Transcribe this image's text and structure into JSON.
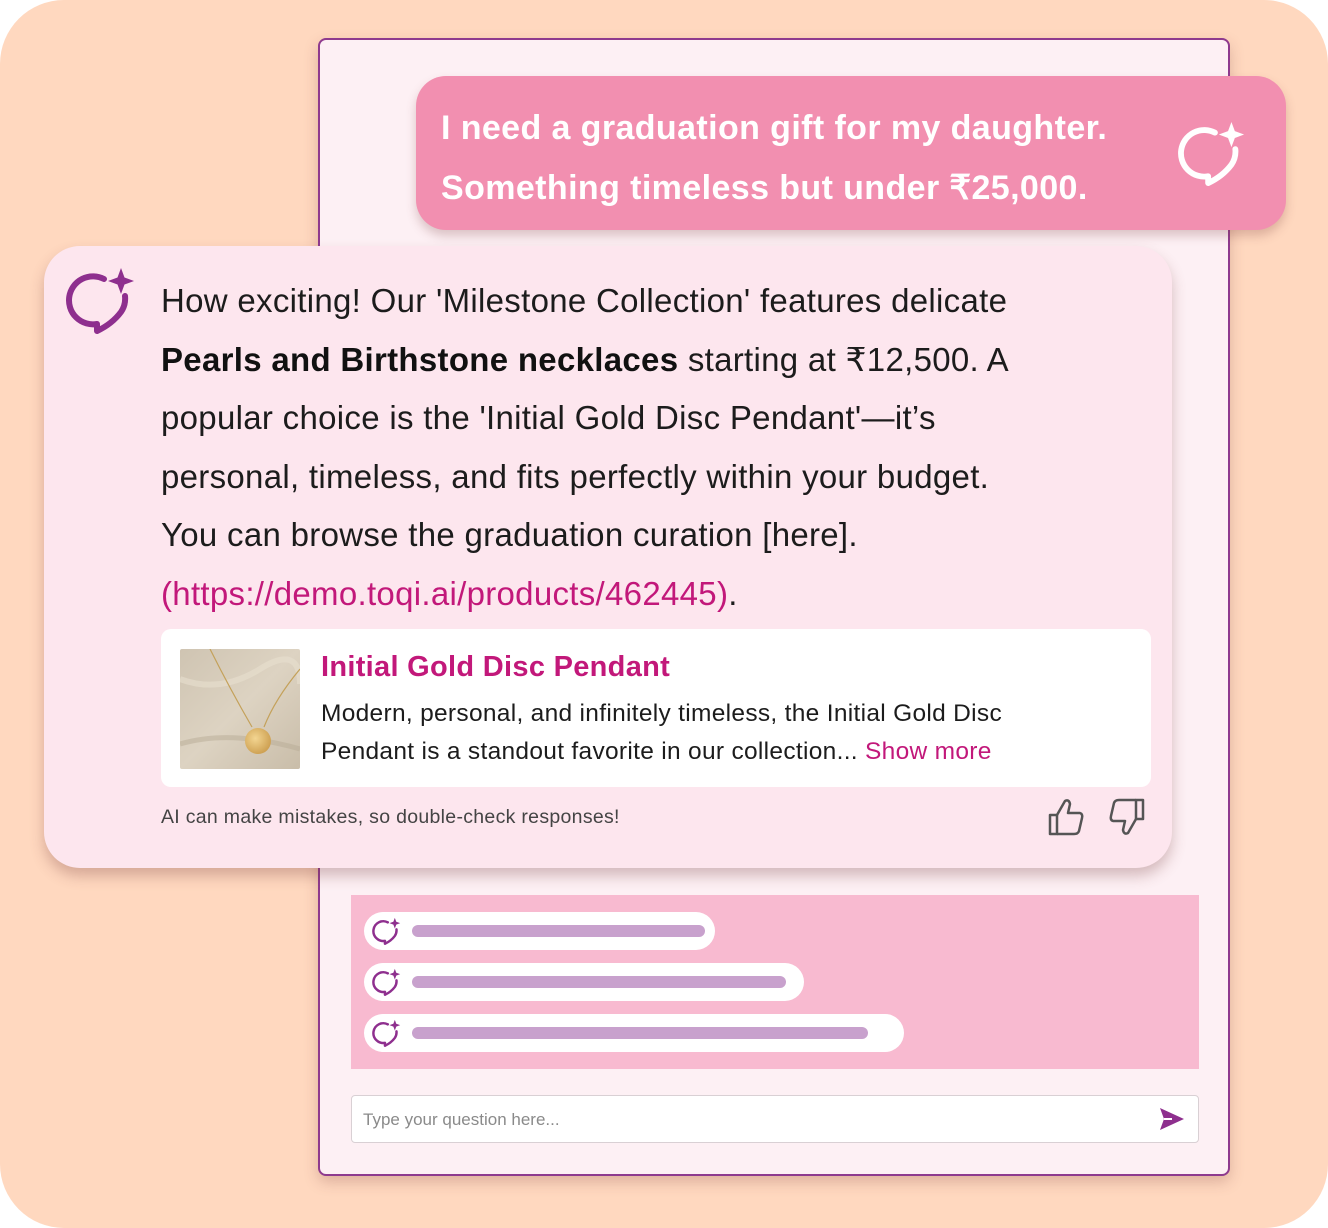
{
  "user_message": {
    "lines": [
      "I need a graduation gift for my daughter.",
      "Something timeless but under ₹25,000."
    ],
    "icon": "ai-chat-sparkle-icon"
  },
  "assistant_message": {
    "icon": "ai-chat-sparkle-icon",
    "line1": "How exciting! Our 'Milestone Collection' features delicate",
    "line2_bold": "Pearls and Birthstone necklaces",
    "line2_rest": " starting at ₹12,500. A",
    "line3": "popular choice is the 'Initial Gold Disc Pendant'—it’s",
    "line4": "personal, timeless, and fits perfectly within your budget.",
    "line5": "You can browse the graduation curation [here].",
    "link": "(https://demo.toqi.ai/products/462445)",
    "link_suffix": "."
  },
  "product": {
    "title": "Initial Gold Disc Pendant",
    "desc_line1": "Modern, personal, and infinitely timeless, the Initial Gold Disc",
    "desc_line2": "Pendant is a standout favorite in our collection...",
    "show_more": "Show more"
  },
  "disclaimer": "AI can make mistakes, so double-check responses!",
  "feedback": {
    "up_icon": "thumbs-up-icon",
    "down_icon": "thumbs-down-icon"
  },
  "input": {
    "placeholder": "Type your question here...",
    "value": ""
  },
  "colors": {
    "background": "#ffd8bf",
    "user_bubble": "#f28fb0",
    "assistant_bubble": "#fde6ee",
    "accent": "#c2187a",
    "icon_purple": "#8e2f8e",
    "suggestions_bg": "#f8bad0"
  }
}
